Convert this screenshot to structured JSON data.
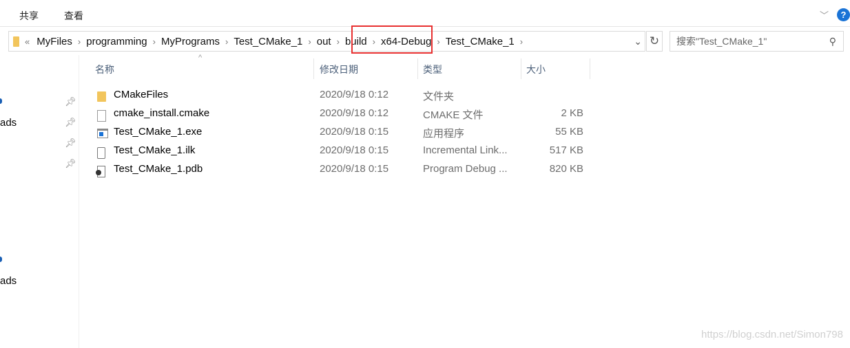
{
  "ribbon": {
    "tabs": [
      "共享",
      "查看"
    ]
  },
  "address": {
    "overflow": "«",
    "crumbs": [
      "MyFiles",
      "programming",
      "MyPrograms",
      "Test_CMake_1",
      "out",
      "build",
      "x64-Debug",
      "Test_CMake_1"
    ]
  },
  "search": {
    "placeholder": "搜索\"Test_CMake_1\""
  },
  "sidebar": {
    "items": [
      "ads",
      "ads"
    ]
  },
  "columns": [
    "名称",
    "修改日期",
    "类型",
    "大小"
  ],
  "files": [
    {
      "name": "CMakeFiles",
      "date": "2020/9/18 0:12",
      "type": "文件夹",
      "size": "",
      "icon": "folder-icon"
    },
    {
      "name": "cmake_install.cmake",
      "date": "2020/9/18 0:12",
      "type": "CMAKE 文件",
      "size": "2 KB",
      "icon": "file-icon"
    },
    {
      "name": "Test_CMake_1.exe",
      "date": "2020/9/18 0:15",
      "type": "应用程序",
      "size": "55 KB",
      "icon": "exe-icon"
    },
    {
      "name": "Test_CMake_1.ilk",
      "date": "2020/9/18 0:15",
      "type": "Incremental Link...",
      "size": "517 KB",
      "icon": "ilk-file-icon"
    },
    {
      "name": "Test_CMake_1.pdb",
      "date": "2020/9/18 0:15",
      "type": "Program Debug ...",
      "size": "820 KB",
      "icon": "pdb-file-icon"
    }
  ],
  "watermark": "https://blog.csdn.net/Simon798",
  "colors": {
    "highlight": "#e83030",
    "help": "#1a73d6"
  }
}
